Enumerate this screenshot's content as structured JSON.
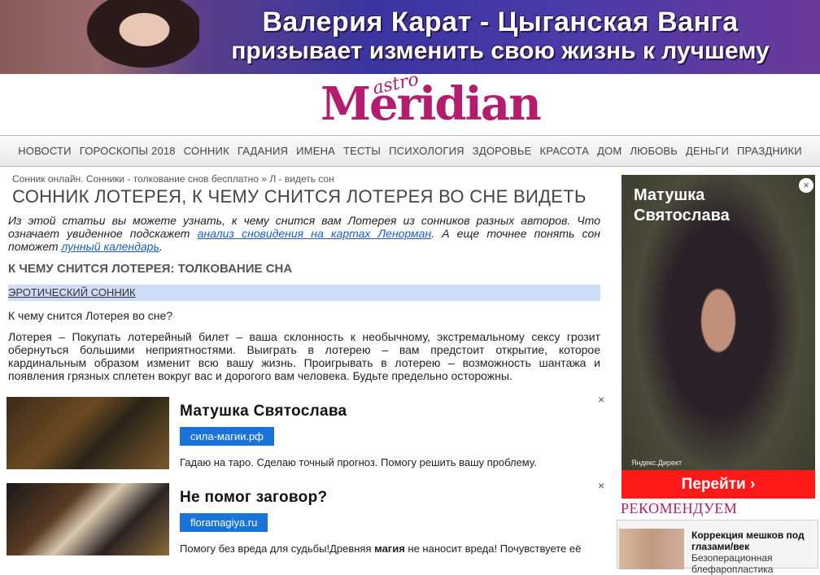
{
  "banner": {
    "line1": "Валерия Карат - Цыганская Ванга",
    "line2": "призывает изменить свою жизнь к лучшему"
  },
  "logo": {
    "astro": "astro",
    "main": "Meridian"
  },
  "nav": [
    "Новости",
    "Гороскопы 2018",
    "Сонник",
    "Гадания",
    "Имена",
    "Тесты",
    "Психология",
    "Здоровье",
    "Красота",
    "Дом",
    "Любовь",
    "Деньги",
    "Праздники"
  ],
  "breadcrumb": {
    "path": "Сонник онлайн. Сонники - толкование снов бесплатно » Л - видеть сон"
  },
  "article": {
    "title": "Сонник Лотерея, к чему снится лотерея во сне видеть",
    "intro_part1": "Из этой статьи вы можете узнать, к чему снится вам Лотерея из сонников разных авторов. Что означает увиденное подскажет ",
    "intro_link1": "анализ сновидения на картах Ленорман",
    "intro_part2": ". А еще точнее понять сон поможет ",
    "intro_link2": "лунный календарь",
    "intro_part3": ".",
    "h2": "К чему снится Лотерея: толкование сна",
    "dream_source": "Эротический сонник",
    "question": "К чему снится Лотерея во сне?",
    "interpretation": "Лотерея – Покупать лотерейный билет – ваша склонность к необычному, экстремальному сексу грозит обернуться большими неприятностями. Выиграть в лотерею – вам предстоит открытие, которое кардинальным образом изменит всю вашу жизнь. Проигрывать в лотерею – возможность шантажа и появления грязных сплетен вокруг вас и дорогого вам человека. Будьте предельно осторожны."
  },
  "ads": [
    {
      "headline": "Матушка Святослава",
      "domain": "сила-магии.рф",
      "text": "Гадаю на таро. Сделаю точный прогноз. Помогу решить вашу проблему.",
      "close": "×"
    },
    {
      "headline": "Не помог заговор?",
      "domain": "floramagiya.ru",
      "text_a": "Помогу без вреда для судьбы!Древняя ",
      "text_b": "магия",
      "text_c": " не наносит вреда! Почувствуете её",
      "close": "×"
    }
  ],
  "side_ad": {
    "headline": "Матушка Святослава",
    "close": "×",
    "source": "Яндекс.Директ",
    "cta": "Перейти ›"
  },
  "recommend": {
    "title": "Рекомендуем",
    "item_title": "Коррекция мешков под глазами/век",
    "item_text": "Безоперационная блефаропластика"
  }
}
